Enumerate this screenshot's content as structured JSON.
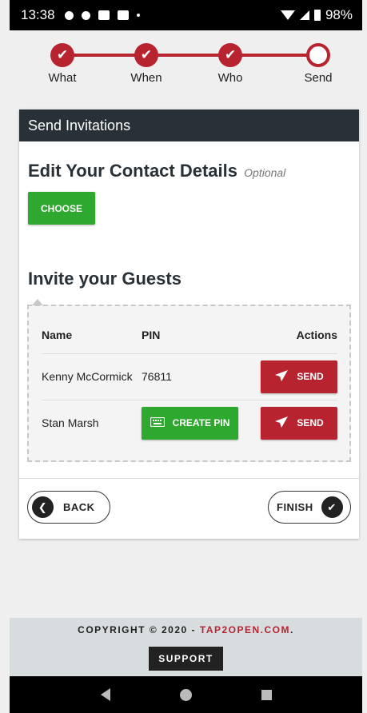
{
  "status_bar": {
    "time": "13:38",
    "battery": "98%"
  },
  "stepper": {
    "steps": [
      {
        "label": "What",
        "state": "done"
      },
      {
        "label": "When",
        "state": "done"
      },
      {
        "label": "Who",
        "state": "done"
      },
      {
        "label": "Send",
        "state": "current"
      }
    ],
    "color": "#b82330"
  },
  "card": {
    "header": "Send Invitations",
    "contact_title": "Edit Your Contact Details",
    "contact_optional": "Optional",
    "choose_label": "CHOOSE",
    "guests_title": "Invite your Guests",
    "table": {
      "headers": {
        "name": "Name",
        "pin": "PIN",
        "actions": "Actions"
      },
      "rows": [
        {
          "name": "Kenny McCormick",
          "pin": "76811",
          "send_label": "SEND"
        },
        {
          "name": "Stan Marsh",
          "pin_button": "CREATE PIN",
          "send_label": "SEND"
        }
      ]
    },
    "back_label": "BACK",
    "finish_label": "FINISH"
  },
  "footer": {
    "copyright_prefix": "COPYRIGHT © 2020 - ",
    "brand": "TAP2OPEN.COM",
    "copyright_suffix": ".",
    "support_label": "SUPPORT"
  },
  "colors": {
    "primary": "#b82330",
    "success": "#2ea82e",
    "dark": "#283138"
  },
  "icons": [
    "check-icon",
    "paper-plane-icon",
    "keyboard-icon",
    "chevron-left-icon",
    "check-circle-icon"
  ]
}
